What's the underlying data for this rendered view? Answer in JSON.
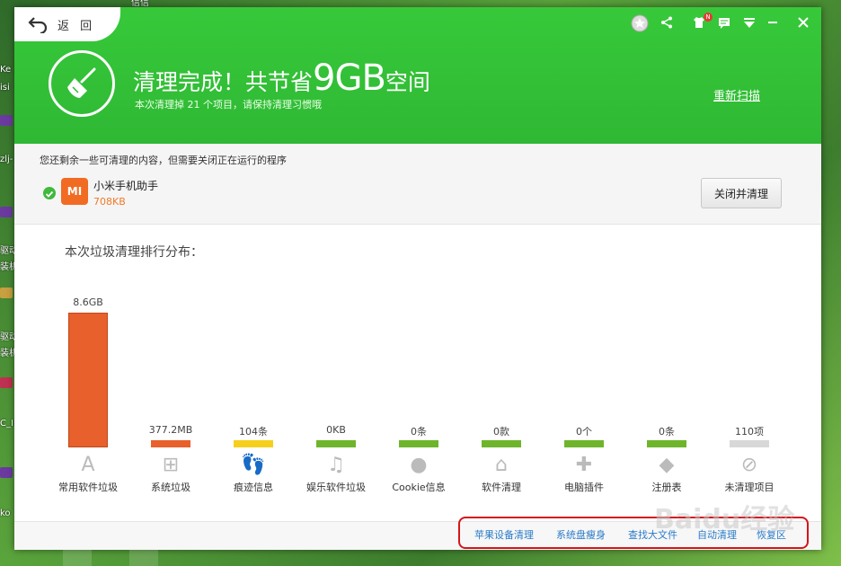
{
  "window": {
    "back_label": "返 回",
    "title_prefix": "清理完成！共节省",
    "title_amount": "9GB",
    "title_suffix": "空间",
    "subtitle": "本次清理掉 21 个项目，请保持清理习惯哦",
    "rescan": "重新扫描",
    "notification_badge": "N",
    "accent_color": "#2fb834"
  },
  "notice": {
    "text": "您还剩余一些可清理的内容，但需要关闭正在运行的程序",
    "app_icon_text": "MI",
    "app_name": "小米手机助手",
    "app_size": "708KB",
    "button": "关闭并清理"
  },
  "chart_data": {
    "type": "bar",
    "title": "本次垃圾清理排行分布：",
    "categories": [
      "常用软件垃圾",
      "系统垃圾",
      "痕迹信息",
      "娱乐软件垃圾",
      "Cookie信息",
      "软件清理",
      "电脑插件",
      "注册表",
      "未清理项目"
    ],
    "value_labels": [
      "8.6GB",
      "377.2MB",
      "104条",
      "0KB",
      "0条",
      "0款",
      "0个",
      "0条",
      "110项"
    ],
    "values": [
      8.6,
      0.3772,
      0,
      0,
      0,
      0,
      0,
      0,
      0
    ],
    "colors": [
      "#e8602c",
      "#e8602c",
      "#f6cf1d",
      "#6fb52c",
      "#6fb52c",
      "#6fb52c",
      "#6fb52c",
      "#6fb52c",
      "#d8d8d8"
    ],
    "icons": [
      "app-store-icon",
      "windows-icon",
      "footprint-icon",
      "music-icon",
      "cookie-icon",
      "broom-icon",
      "plugin-icon",
      "registry-icon",
      "forbidden-icon"
    ]
  },
  "footer": {
    "links": [
      "苹果设备清理",
      "系统盘瘦身",
      "查找大文件",
      "自动清理",
      "恢复区"
    ]
  },
  "desktop": {
    "labels": [
      "Ke",
      "isi",
      "zlj-",
      "驱动",
      "装机",
      "驱动",
      "装机",
      "C_I",
      "ko",
      "信信"
    ]
  },
  "watermark": "Baidu经验"
}
